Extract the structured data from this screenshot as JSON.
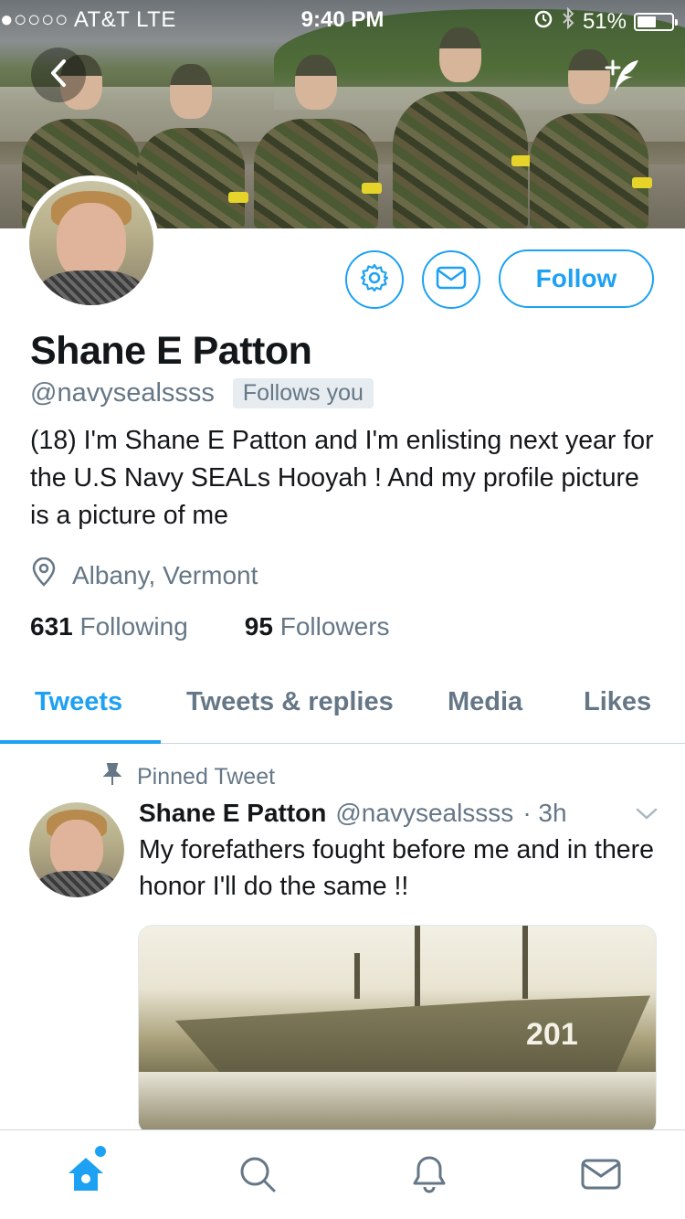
{
  "status_bar": {
    "carrier": "●○○○○ AT&T  LTE",
    "time": "9:40 PM",
    "battery": "51%",
    "battery_level": 0.51
  },
  "profile": {
    "name": "Shane E Patton",
    "handle": "@navysealssss",
    "follows_you": "Follows you",
    "bio": "(18) I'm Shane E Patton and I'm enlisting next year for the U.S Navy SEALs Hooyah ! And my profile picture is a picture of me",
    "location": "Albany, Vermont",
    "following_count": "631",
    "following_label": "Following",
    "followers_count": "95",
    "followers_label": "Followers"
  },
  "actions": {
    "follow_label": "Follow",
    "settings_icon": "gear-icon",
    "message_icon": "envelope-icon"
  },
  "tabs": [
    {
      "label": "Tweets",
      "active": true
    },
    {
      "label": "Tweets & replies",
      "active": false
    },
    {
      "label": "Media",
      "active": false
    },
    {
      "label": "Likes",
      "active": false
    }
  ],
  "tweet": {
    "pinned_label": "Pinned Tweet",
    "name": "Shane E Patton",
    "handle": "@navysealssss",
    "time": "· 3h",
    "text": "My forefathers fought before me and in there honor I'll do the same !!",
    "media_text": "201"
  },
  "bottom_nav": [
    "home-icon",
    "search-icon",
    "bell-icon",
    "envelope-icon"
  ],
  "colors": {
    "accent": "#1da1f2",
    "secondary_text": "#657786",
    "primary_text": "#14171a"
  }
}
